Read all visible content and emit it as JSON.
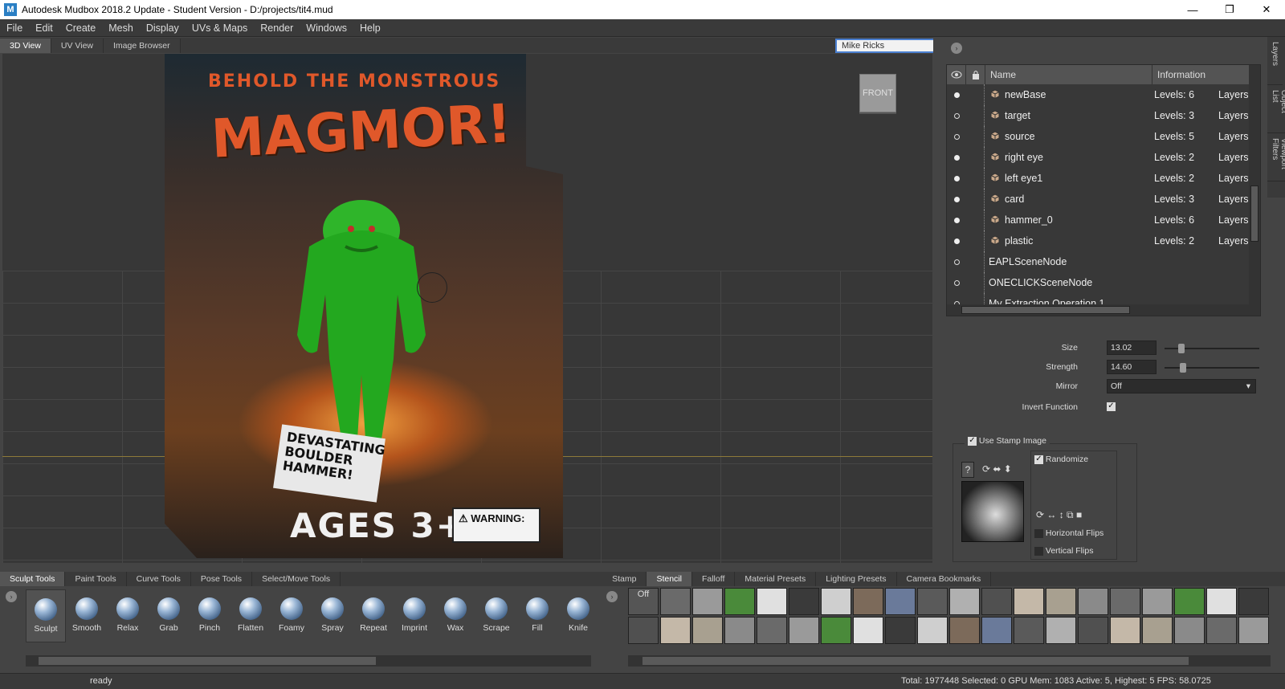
{
  "window": {
    "title": "Autodesk Mudbox 2018.2 Update - Student Version - D:/projects/tit4.mud",
    "logo": "M",
    "minimize": "—",
    "restore": "❐",
    "close": "✕"
  },
  "menu": [
    "File",
    "Edit",
    "Create",
    "Mesh",
    "Display",
    "UVs & Maps",
    "Render",
    "Windows",
    "Help"
  ],
  "view_tabs": [
    "3D View",
    "UV View",
    "Image Browser"
  ],
  "camera": "Mike Ricks",
  "viewport": {
    "cube_label": "FRONT",
    "card": {
      "headline": "BEHOLD THE MONSTROUS",
      "name": "MAGMOR!",
      "tagline": "DEVASTATING\nBOULDER\nHAMMER!",
      "ages": "AGES 3+",
      "warning": "WARNING:"
    }
  },
  "object_list": {
    "col_name": "Name",
    "col_info": "Information",
    "rows": [
      {
        "name": "newBase",
        "levels": "Levels: 6",
        "layers": "Layers",
        "visible": true,
        "mesh": true
      },
      {
        "name": "target",
        "levels": "Levels: 3",
        "layers": "Layers",
        "visible": false,
        "mesh": true
      },
      {
        "name": "source",
        "levels": "Levels: 5",
        "layers": "Layers",
        "visible": false,
        "mesh": true
      },
      {
        "name": "right eye",
        "levels": "Levels: 2",
        "layers": "Layers",
        "visible": true,
        "mesh": true
      },
      {
        "name": "left eye1",
        "levels": "Levels: 2",
        "layers": "Layers",
        "visible": true,
        "mesh": true
      },
      {
        "name": "card",
        "levels": "Levels: 3",
        "layers": "Layers",
        "visible": true,
        "mesh": true
      },
      {
        "name": "hammer_0",
        "levels": "Levels: 6",
        "layers": "Layers",
        "visible": true,
        "mesh": true
      },
      {
        "name": "plastic",
        "levels": "Levels: 2",
        "layers": "Layers",
        "visible": true,
        "mesh": true
      },
      {
        "name": "EAPLSceneNode",
        "levels": "",
        "layers": "",
        "visible": false,
        "mesh": false
      },
      {
        "name": "ONECLICKSceneNode",
        "levels": "",
        "layers": "",
        "visible": false,
        "mesh": false
      },
      {
        "name": "My Extraction Operation 1",
        "levels": "",
        "layers": "",
        "visible": false,
        "mesh": false
      }
    ]
  },
  "side_tabs": [
    "Layers",
    "Object List",
    "Viewport Filters"
  ],
  "properties": {
    "size_label": "Size",
    "size_value": "13.02",
    "size_fraction": 0.15,
    "strength_label": "Strength",
    "strength_value": "14.60",
    "strength_fraction": 0.17,
    "mirror_label": "Mirror",
    "mirror_value": "Off",
    "invert_label": "Invert Function",
    "invert_checked": true,
    "use_stamp_label": "Use Stamp Image",
    "use_stamp_checked": true,
    "randomize_label": "Randomize",
    "randomize_checked": true,
    "hflip_label": "Horizontal Flips",
    "vflip_label": "Vertical Flips"
  },
  "bottom_left_tabs": [
    "Sculpt Tools",
    "Paint Tools",
    "Curve Tools",
    "Pose Tools",
    "Select/Move Tools"
  ],
  "bottom_right_tabs": [
    "Stamp",
    "Stencil",
    "Falloff",
    "Material Presets",
    "Lighting Presets",
    "Camera Bookmarks"
  ],
  "tools": [
    "Sculpt",
    "Smooth",
    "Relax",
    "Grab",
    "Pinch",
    "Flatten",
    "Foamy",
    "Spray",
    "Repeat",
    "Imprint",
    "Wax",
    "Scrape",
    "Fill",
    "Knife"
  ],
  "stencil_off_label": "Off",
  "status": {
    "ready": "ready",
    "info": "Total: 1977448  Selected: 0 GPU Mem: 1083  Active: 5, Highest: 5  FPS: 58.0725"
  }
}
